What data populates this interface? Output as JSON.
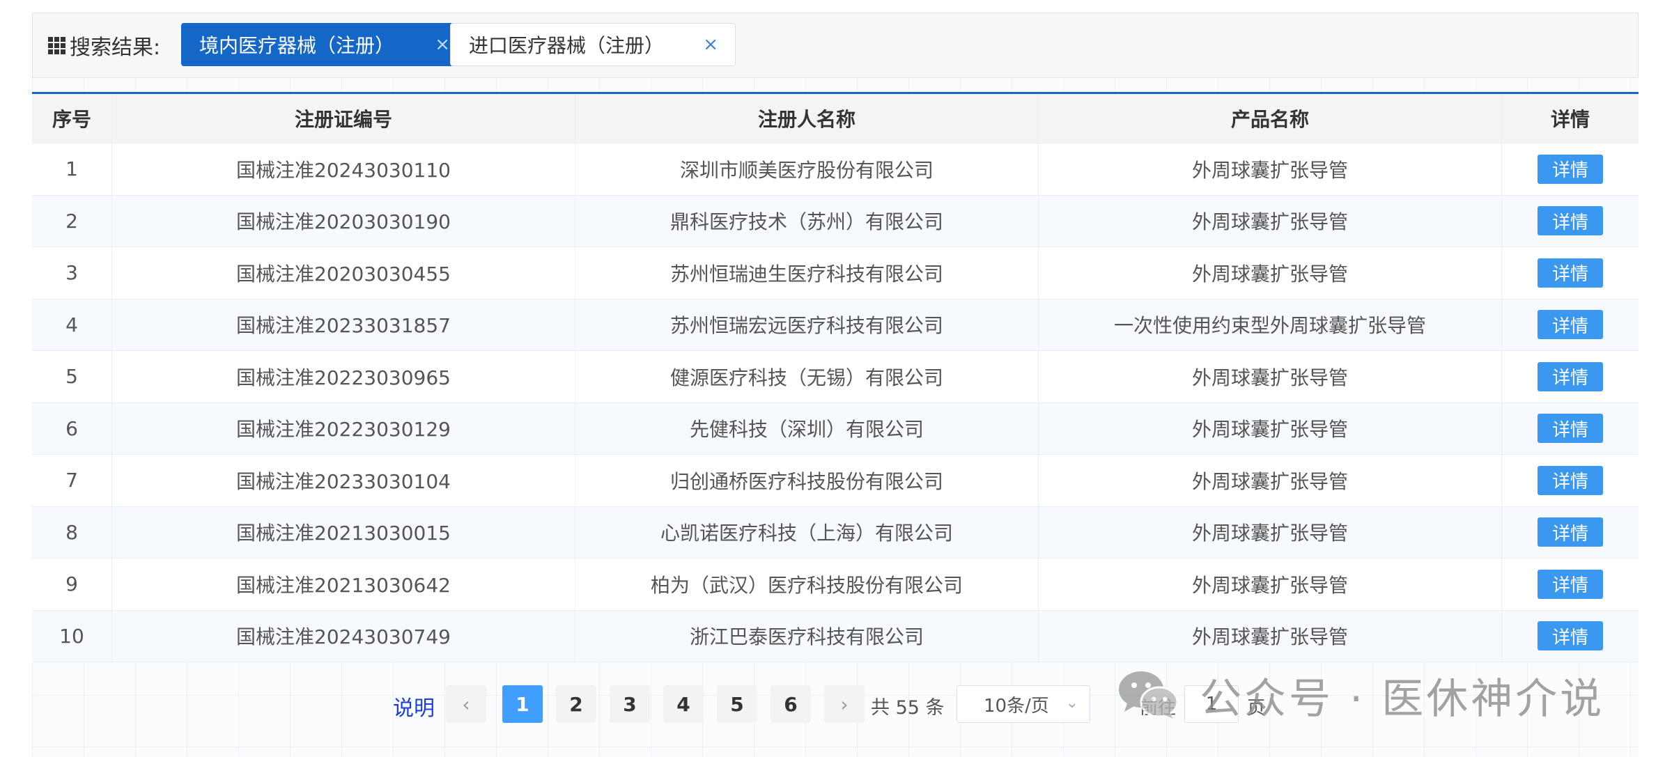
{
  "search": {
    "label": "搜索结果:",
    "tags": [
      {
        "label": "境内医疗器械（注册）",
        "active": true
      },
      {
        "label": "进口医疗器械（注册）",
        "active": false
      }
    ],
    "close_glyph": "×"
  },
  "table": {
    "headers": [
      "序号",
      "注册证编号",
      "注册人名称",
      "产品名称",
      "详情"
    ],
    "rows": [
      [
        "1",
        "国械注准20243030110",
        "深圳市顺美医疗股份有限公司",
        "外周球囊扩张导管",
        "详情"
      ],
      [
        "2",
        "国械注准20203030190",
        "鼎科医疗技术（苏州）有限公司",
        "外周球囊扩张导管",
        "详情"
      ],
      [
        "3",
        "国械注准20203030455",
        "苏州恒瑞迪生医疗科技有限公司",
        "外周球囊扩张导管",
        "详情"
      ],
      [
        "4",
        "国械注准20233031857",
        "苏州恒瑞宏远医疗科技有限公司",
        "一次性使用约束型外周球囊扩张导管",
        "详情"
      ],
      [
        "5",
        "国械注准20223030965",
        "健源医疗科技（无锡）有限公司",
        "外周球囊扩张导管",
        "详情"
      ],
      [
        "6",
        "国械注准20223030129",
        "先健科技（深圳）有限公司",
        "外周球囊扩张导管",
        "详情"
      ],
      [
        "7",
        "国械注准20233030104",
        "归创通桥医疗科技股份有限公司",
        "外周球囊扩张导管",
        "详情"
      ],
      [
        "8",
        "国械注准20213030015",
        "心凯诺医疗科技（上海）有限公司",
        "外周球囊扩张导管",
        "详情"
      ],
      [
        "9",
        "国械注准20213030642",
        "柏为（武汉）医疗科技股份有限公司",
        "外周球囊扩张导管",
        "详情"
      ],
      [
        "10",
        "国械注准20243030749",
        "浙江巴泰医疗科技有限公司",
        "外周球囊扩张导管",
        "详情"
      ]
    ]
  },
  "pagination": {
    "help_label": "说明",
    "prev_glyph": "‹",
    "next_glyph": "›",
    "pages": [
      "1",
      "2",
      "3",
      "4",
      "5",
      "6"
    ],
    "current_page": "1",
    "total_text": "共 55 条",
    "page_size": "10条/页",
    "goto_label": "前往",
    "goto_value": "1",
    "page_unit": "页"
  },
  "watermark": {
    "text": "公众号 · 医休神介说"
  },
  "colors": {
    "accent": "#1467c7",
    "button": "#3a98f0",
    "active_page": "#409eff",
    "help_link": "#1a3fd6"
  }
}
